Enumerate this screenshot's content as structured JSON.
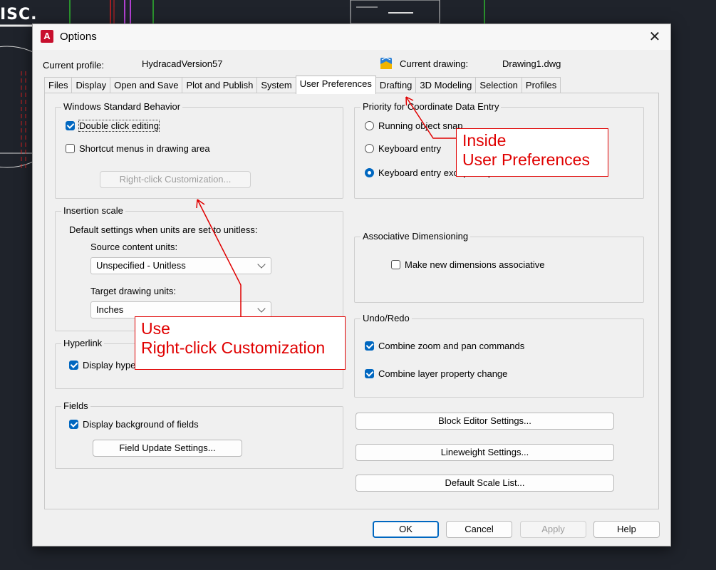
{
  "background": {
    "corner_text": "ISC."
  },
  "dialog": {
    "title": "Options",
    "app_icon": "A",
    "close_icon": "✕",
    "current_profile_label": "Current profile:",
    "current_profile_value": "HydracadVersion57",
    "current_drawing_label": "Current drawing:",
    "current_drawing_value": "Drawing1.dwg",
    "tabs": [
      {
        "label": "Files"
      },
      {
        "label": "Display"
      },
      {
        "label": "Open and Save"
      },
      {
        "label": "Plot and Publish"
      },
      {
        "label": "System"
      },
      {
        "label": "User Preferences",
        "active": true
      },
      {
        "label": "Drafting"
      },
      {
        "label": "3D Modeling"
      },
      {
        "label": "Selection"
      },
      {
        "label": "Profiles"
      }
    ]
  },
  "windows_behavior": {
    "title": "Windows Standard Behavior",
    "double_click_editing": "Double click editing",
    "shortcut_menus": "Shortcut menus in drawing area",
    "right_click_button": "Right-click Customization..."
  },
  "insertion_scale": {
    "title": "Insertion scale",
    "description": "Default settings when units are set to unitless:",
    "source_label": "Source content units:",
    "source_value": "Unspecified - Unitless",
    "target_label": "Target drawing units:",
    "target_value": "Inches"
  },
  "hyperlink": {
    "title": "Hyperlink",
    "display_label": "Display hype"
  },
  "fields": {
    "title": "Fields",
    "display_background": "Display background of fields",
    "update_button": "Field Update Settings..."
  },
  "coordinate_priority": {
    "title": "Priority for Coordinate Data Entry",
    "running_snap": "Running object snap",
    "keyboard_entry": "Keyboard entry",
    "keyboard_except": "Keyboard entry except scripts"
  },
  "assoc_dim": {
    "title": "Associative Dimensioning",
    "make_new": "Make new dimensions associative"
  },
  "undo_redo": {
    "title": "Undo/Redo",
    "combine_zoom": "Combine zoom and pan commands",
    "combine_layer": "Combine layer property change"
  },
  "buttons": {
    "block_editor": "Block Editor Settings...",
    "lineweight": "Lineweight Settings...",
    "default_scale": "Default Scale List...",
    "ok": "OK",
    "cancel": "Cancel",
    "apply": "Apply",
    "help": "Help"
  },
  "annotations": {
    "callout_top_line1": "Inside",
    "callout_top_line2": "User Preferences",
    "callout_bottom_line1": "Use",
    "callout_bottom_line2": "Right-click Customization",
    "color": "#e00000"
  }
}
